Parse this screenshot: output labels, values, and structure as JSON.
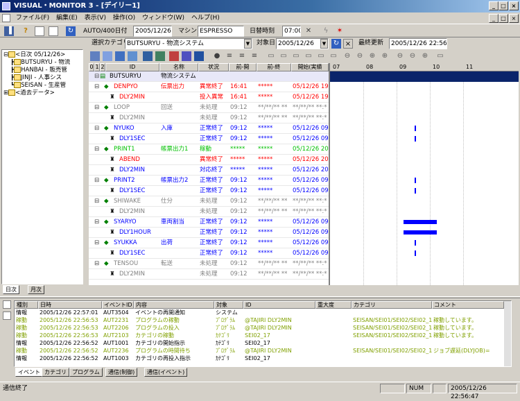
{
  "window": {
    "title": "VISUAL・MONITOR 3 - [デイリー1]"
  },
  "menu": [
    "ファイル(F)",
    "編集(E)",
    "表示(V)",
    "操作(O)",
    "ウィンドウ(W)",
    "ヘルプ(H)"
  ],
  "toolbar": {
    "auto_label": "AUTO/400日付",
    "date_value": "2005/12/26",
    "machine_label": "マシン",
    "machine_value": "ESPRESSO",
    "switch_label": "日替時刻",
    "switch_value": "07:00"
  },
  "filterbar": {
    "category_label": "選択カテゴリ",
    "category_value": "BUTSURYU - 物流システム",
    "target_label": "対象日",
    "target_value": "2005/12/26",
    "update_label": "最終更新",
    "update_value": "2005/12/26 22:56:53"
  },
  "tree": {
    "items": [
      {
        "label": "<日次 05/12/26>",
        "level": 0
      },
      {
        "label": "BUTSURYU - 物流",
        "level": 1
      },
      {
        "label": "HANBAI - 販売管",
        "level": 1
      },
      {
        "label": "JINJI - 人事シス",
        "level": 1
      },
      {
        "label": "SEISAN - 生産管",
        "level": 1
      },
      {
        "label": "<過去データ>",
        "level": 0
      }
    ],
    "tabs": [
      "日次",
      "月次"
    ]
  },
  "grid": {
    "headers": [
      "0",
      "1",
      "2",
      "ID",
      "名称",
      "状況",
      "前-開",
      "前-終",
      "開始(実績"
    ],
    "rows": [
      {
        "id": "BUTSURYU",
        "name": "物流システム",
        "status": "",
        "start": "",
        "end": "",
        "actual": "",
        "color": "#000000",
        "kind": "root"
      },
      {
        "id": "DENPYO",
        "name": "伝票出力",
        "status": "異常終了",
        "start": "16:41",
        "end": "*****",
        "actual": "05/12/26 19:1",
        "color": "#ff0000",
        "kind": "job"
      },
      {
        "id": "DLY2MIN",
        "name": "",
        "status": "投入異常",
        "start": "16:41",
        "end": "*****",
        "actual": "05/12/26 19:1",
        "color": "#ff0000",
        "kind": "sub"
      },
      {
        "id": "LOOP",
        "name": "回送",
        "status": "未処理",
        "start": "09:12",
        "end": "**/**/** **",
        "actual": "**/**/** **:*",
        "color": "#808080",
        "kind": "job"
      },
      {
        "id": "DLY2MIN",
        "name": "",
        "status": "未処理",
        "start": "09:12",
        "end": "**/**/** **",
        "actual": "**/**/** **:*",
        "color": "#808080",
        "kind": "sub"
      },
      {
        "id": "NYUKO",
        "name": "入庫",
        "status": "正常終了",
        "start": "09:12",
        "end": "*****",
        "actual": "05/12/26 09:4",
        "color": "#0000ff",
        "kind": "job"
      },
      {
        "id": "DLY1SEC",
        "name": "",
        "status": "正常終了",
        "start": "09:12",
        "end": "*****",
        "actual": "05/12/26 09:4",
        "color": "#0000ff",
        "kind": "sub"
      },
      {
        "id": "PRINT1",
        "name": "帳票出力1",
        "status": "稼動",
        "start": "*****",
        "end": "*****",
        "actual": "05/12/26 20:0",
        "color": "#00c000",
        "kind": "job"
      },
      {
        "id": "ABEND",
        "name": "",
        "status": "異常終了",
        "start": "*****",
        "end": "*****",
        "actual": "05/12/26 20:0",
        "color": "#ff0000",
        "kind": "sub"
      },
      {
        "id": "DLY2MIN",
        "name": "",
        "status": "対応終了",
        "start": "*****",
        "end": "*****",
        "actual": "05/12/26 20:0",
        "color": "#0000ff",
        "kind": "sub"
      },
      {
        "id": "PRINT2",
        "name": "帳票出力2",
        "status": "正常終了",
        "start": "09:12",
        "end": "*****",
        "actual": "05/12/26 09:4",
        "color": "#0000ff",
        "kind": "job"
      },
      {
        "id": "DLY1SEC",
        "name": "",
        "status": "正常終了",
        "start": "09:12",
        "end": "*****",
        "actual": "05/12/26 09:4",
        "color": "#0000ff",
        "kind": "sub"
      },
      {
        "id": "SHIWAKE",
        "name": "仕分",
        "status": "未処理",
        "start": "09:12",
        "end": "**/**/** **",
        "actual": "**/**/** **:*",
        "color": "#808080",
        "kind": "job"
      },
      {
        "id": "DLY2MIN",
        "name": "",
        "status": "未処理",
        "start": "09:12",
        "end": "**/**/** **",
        "actual": "**/**/** **:*",
        "color": "#808080",
        "kind": "sub"
      },
      {
        "id": "SYARYO",
        "name": "車両割当",
        "status": "正常終了",
        "start": "09:12",
        "end": "*****",
        "actual": "05/12/26 09:1",
        "color": "#0000ff",
        "kind": "job"
      },
      {
        "id": "DLY1HOUR",
        "name": "",
        "status": "正常終了",
        "start": "09:12",
        "end": "*****",
        "actual": "05/12/26 09:1",
        "color": "#0000ff",
        "kind": "sub"
      },
      {
        "id": "SYUKKA",
        "name": "出荷",
        "status": "正常終了",
        "start": "09:12",
        "end": "*****",
        "actual": "05/12/26 09:4",
        "color": "#0000ff",
        "kind": "job"
      },
      {
        "id": "DLY1SEC",
        "name": "",
        "status": "正常終了",
        "start": "09:12",
        "end": "*****",
        "actual": "05/12/26 09:4",
        "color": "#0000ff",
        "kind": "sub"
      },
      {
        "id": "TENSOU",
        "name": "転送",
        "status": "未処理",
        "start": "09:12",
        "end": "**/**/** **",
        "actual": "**/**/** **:*",
        "color": "#808080",
        "kind": "job"
      },
      {
        "id": "DLY2MIN",
        "name": "",
        "status": "未処理",
        "start": "09:12",
        "end": "**/**/** **",
        "actual": "**/**/** **:*",
        "color": "#808080",
        "kind": "sub"
      }
    ]
  },
  "gantt": {
    "hours": [
      "07",
      "08",
      "09",
      "10",
      "11"
    ],
    "bars": [
      {
        "row": 5,
        "start_hour": 9.55,
        "end_hour": 9.57
      },
      {
        "row": 6,
        "start_hour": 9.55,
        "end_hour": 9.57
      },
      {
        "row": 10,
        "start_hour": 9.55,
        "end_hour": 9.57
      },
      {
        "row": 11,
        "start_hour": 9.55,
        "end_hour": 9.57
      },
      {
        "row": 14,
        "start_hour": 9.2,
        "end_hour": 10.2
      },
      {
        "row": 15,
        "start_hour": 9.2,
        "end_hour": 10.2
      },
      {
        "row": 16,
        "start_hour": 9.55,
        "end_hour": 9.57
      },
      {
        "row": 17,
        "start_hour": 9.55,
        "end_hour": 9.57
      }
    ]
  },
  "events": {
    "headers": [
      "種別",
      "日時",
      "イベントID",
      "内容",
      "対象",
      "ID",
      "重大度",
      "カテゴリ",
      "コメント"
    ],
    "rows": [
      {
        "type": "情報",
        "time": "2005/12/26 22:57:01",
        "eid": "AUT3504",
        "content": "イベントの再開通知",
        "target": "システム",
        "id": "",
        "sev": "",
        "cat": "",
        "comment": "",
        "color": "#000000"
      },
      {
        "type": "稼動",
        "time": "2005/12/26 22:56:53",
        "eid": "AUT2231",
        "content": "プログラムの稼動",
        "target": "ﾌﾟﾛｸﾞﾗﾑ",
        "id": "@TAJIRI DLY2MIN",
        "sev": "",
        "cat": "SEISAN/SEI01/SEI02/SEI02_17",
        "comment": "稼動しています。",
        "color": "#80a000"
      },
      {
        "type": "稼動",
        "time": "2005/12/26 22:56:53",
        "eid": "AUT2206",
        "content": "プログラムの投入",
        "target": "ﾌﾟﾛｸﾞﾗﾑ",
        "id": "@TAJIRI DLY2MIN",
        "sev": "",
        "cat": "SEISAN/SEI01/SEI02/SEI02_17",
        "comment": "稼動しています。",
        "color": "#80a000"
      },
      {
        "type": "稼動",
        "time": "2005/12/26 22:56:53",
        "eid": "AUT2103",
        "content": "カテゴリの稼動",
        "target": "ｶﾃｺﾞﾘ",
        "id": "SEI02_17",
        "sev": "",
        "cat": "SEISAN/SEI01/SEI02/SEI02_17",
        "comment": "稼動しています。",
        "color": "#80a000"
      },
      {
        "type": "情報",
        "time": "2005/12/26 22:56:52",
        "eid": "AUT1001",
        "content": "カテゴリの開始指示",
        "target": "ｶﾃｺﾞﾘ",
        "id": "SEI02_17",
        "sev": "",
        "cat": "",
        "comment": "",
        "color": "#000000"
      },
      {
        "type": "稼動",
        "time": "2005/12/26 22:56:52",
        "eid": "AUT2236",
        "content": "プログラムの時間待ち",
        "target": "ﾌﾟﾛｸﾞﾗﾑ",
        "id": "@TAJIRI DLY2MIN",
        "sev": "",
        "cat": "SEISAN/SEI01/SEI02/SEI02_14",
        "comment": "ジョブ遅延(DLYJOB)=",
        "color": "#80a000"
      },
      {
        "type": "情報",
        "time": "2005/12/26 22:56:52",
        "eid": "AUT1003",
        "content": "カテゴリの再投入指示",
        "target": "ｶﾃｺﾞﾘ",
        "id": "SEI02_17",
        "sev": "",
        "cat": "",
        "comment": "",
        "color": "#000000"
      }
    ],
    "tabs": [
      "イベント",
      "カテゴリ",
      "プログラム",
      "通信(制御)",
      "通信(イベント)"
    ]
  },
  "statusbar": {
    "message": "通信終了",
    "num": "NUM",
    "datetime": "2005/12/26 22:56:47"
  },
  "colors": {
    "title_start": "#0a246a",
    "selected_row": "#0a246a"
  }
}
